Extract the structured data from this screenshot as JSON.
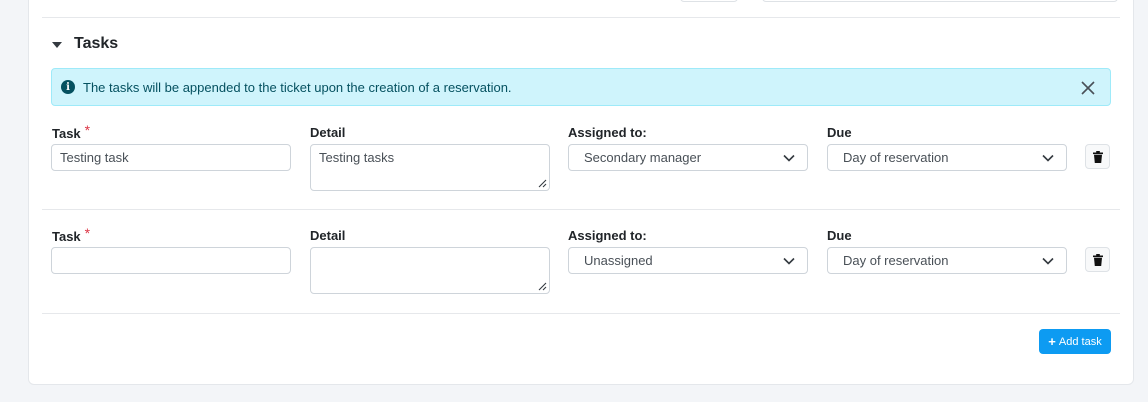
{
  "section": {
    "title": "Tasks"
  },
  "alert": {
    "text": "The tasks will be appended to the ticket upon the creation of a reservation."
  },
  "labels": {
    "task": "Task",
    "required": "*",
    "detail": "Detail",
    "assigned": "Assigned to:",
    "due": "Due"
  },
  "tasks": [
    {
      "task": "Testing task",
      "detail": "Testing tasks",
      "assigned": "Secondary manager",
      "due": "Day of reservation"
    },
    {
      "task": "",
      "detail": "",
      "assigned": "Unassigned",
      "due": "Day of reservation"
    }
  ],
  "add_button": {
    "label": "Add task"
  },
  "colors": {
    "accent": "#0d9bf2",
    "alert_bg": "#cff4fc",
    "alert_text": "#055160",
    "required": "#dc3545"
  }
}
